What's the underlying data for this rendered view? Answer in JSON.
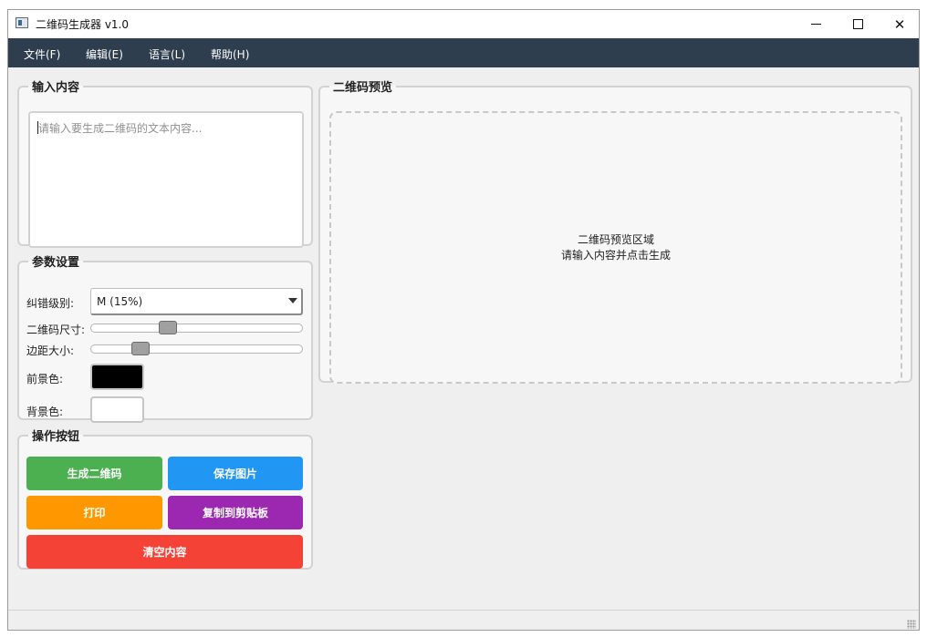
{
  "window": {
    "title": "二维码生成器 v1.0",
    "minimize_glyph": "—",
    "maximize_glyph": "☐",
    "close_glyph": "✕"
  },
  "menu": [
    {
      "label": "文件(F)"
    },
    {
      "label": "编辑(E)"
    },
    {
      "label": "语言(L)"
    },
    {
      "label": "帮助(H)"
    }
  ],
  "input_group": {
    "title": "输入内容",
    "placeholder": "请输入要生成二维码的文本内容...",
    "value": ""
  },
  "params_group": {
    "title": "参数设置",
    "error_level_label": "纠错级别:",
    "error_level_value": "M (15%)",
    "qr_size_label": "二维码尺寸:",
    "qr_size_fraction": 0.35,
    "margin_label": "边距大小:",
    "margin_fraction": 0.21,
    "fg_label": "前景色:",
    "fg_color": "#000000",
    "bg_label": "背景色:",
    "bg_color": "#ffffff"
  },
  "actions_group": {
    "title": "操作按钮",
    "buttons": [
      {
        "label": "生成二维码",
        "color": "#4caf50"
      },
      {
        "label": "保存图片",
        "color": "#2196f3"
      },
      {
        "label": "打印",
        "color": "#ff9800"
      },
      {
        "label": "复制到剪贴板",
        "color": "#9c27b0"
      },
      {
        "label": "清空内容",
        "color": "#f44336"
      }
    ]
  },
  "preview_group": {
    "title": "二维码预览",
    "line1": "二维码预览区域",
    "line2": "请输入内容并点击生成"
  },
  "status_text": ""
}
